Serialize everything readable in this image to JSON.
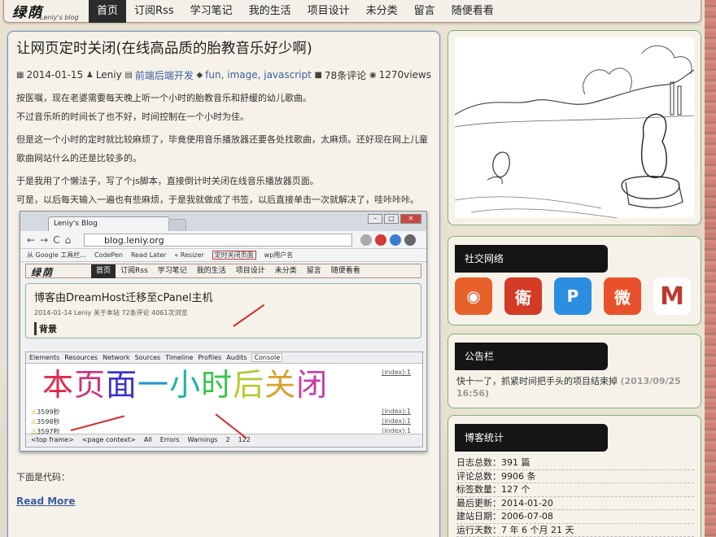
{
  "site": {
    "logo": "绿荫",
    "logo_sub": "Leniy's blog"
  },
  "nav": [
    "首页",
    "订阅Rss",
    "学习笔记",
    "我的生活",
    "项目设计",
    "未分类",
    "留言",
    "随便看看"
  ],
  "post": {
    "title": "让网页定时关闭(在线高品质的胎教音乐好少啊)",
    "date": "2014-01-15",
    "author": "Leniy",
    "category": "前端后端开发",
    "tags": "fun, image, javascript",
    "comments": "78条评论",
    "views": "1270views",
    "paragraphs": [
      [
        "按医嘱，现在老婆需要每天晚上听一个小时的胎教音乐和舒缓的幼儿歌曲。",
        "不过音乐听的时间长了也不好，时间控制在一个小时为佳。"
      ],
      [
        "但是这一个小时的定时就比较麻烦了，毕竟使用音乐播放器还要各处找歌曲，太麻烦。还好现在网上儿童歌曲网站什么的还是比较多的。"
      ],
      [
        "于是我用了个懒法子，写了个js脚本，直接倒计时关闭在线音乐播放器页面。",
        "可是，以后每天输入一遍也有些麻烦，于是我就做成了书签，以后直接单击一次就解决了，哇咔咔咔。"
      ]
    ],
    "after_text": "下面是代码：",
    "read_more": "Read More"
  },
  "screenshot": {
    "tab_title": "Leniy's Blog",
    "url": "blog.leniy.org",
    "bookmarks": [
      "从 Google 工具栏...",
      "CodePen",
      "Read Later",
      "« Resizer",
      "定时关闭页面",
      "wp用户名"
    ],
    "inner_logo": "绿荫",
    "inner_logo_sub": "Leniy's blog",
    "inner_nav": [
      "首页",
      "订阅Rss",
      "学习笔记",
      "我的生活",
      "项目设计",
      "未分类",
      "留言",
      "随便看看"
    ],
    "inner_title": "博客由DreamHost迁移至cPanel主机",
    "inner_meta": "2014-01-14  Leniy  关于本站   72条评论  4061次浏览",
    "inner_heading": "背景",
    "devtools_tabs": [
      "Elements",
      "Resources",
      "Network",
      "Sources",
      "Timeline",
      "Profiles",
      "Audits",
      "Console"
    ],
    "rainbow": [
      "本",
      "页",
      "面",
      "一",
      "小",
      "时",
      "后",
      "关",
      "闭"
    ],
    "index_label": "(index):1",
    "warnings": [
      "3599秒",
      "3598秒",
      "3597秒"
    ],
    "bottom_bar": [
      "<top frame>",
      "<page context>",
      "All",
      "Errors",
      "Warnings",
      "2",
      "122"
    ]
  },
  "sidebar": {
    "social_title": "社交网络",
    "social_icons": [
      "rss-icon",
      "renren-icon",
      "qzone-icon",
      "weibo-icon",
      "gmail-icon"
    ],
    "social_glyphs": [
      "◉",
      "衛",
      "P",
      "微",
      "M"
    ],
    "social_colors": [
      "#e8602a",
      "#d43b25",
      "#2c8ee0",
      "#e9502b",
      "#ffffff"
    ],
    "notice_title": "公告栏",
    "notice_text": "快十一了，抓紧时间把手头的项目结束掉",
    "notice_date": "(2013/09/25 16:56)",
    "stats_title": "博客统计",
    "stats": [
      "日志总数：391 篇",
      "评论总数：9906 条",
      "标签数量：127 个",
      "最后更新：2014-01-20",
      "建站日期：2006-07-08",
      "运行天数：7 年 6 个月 21 天"
    ]
  }
}
